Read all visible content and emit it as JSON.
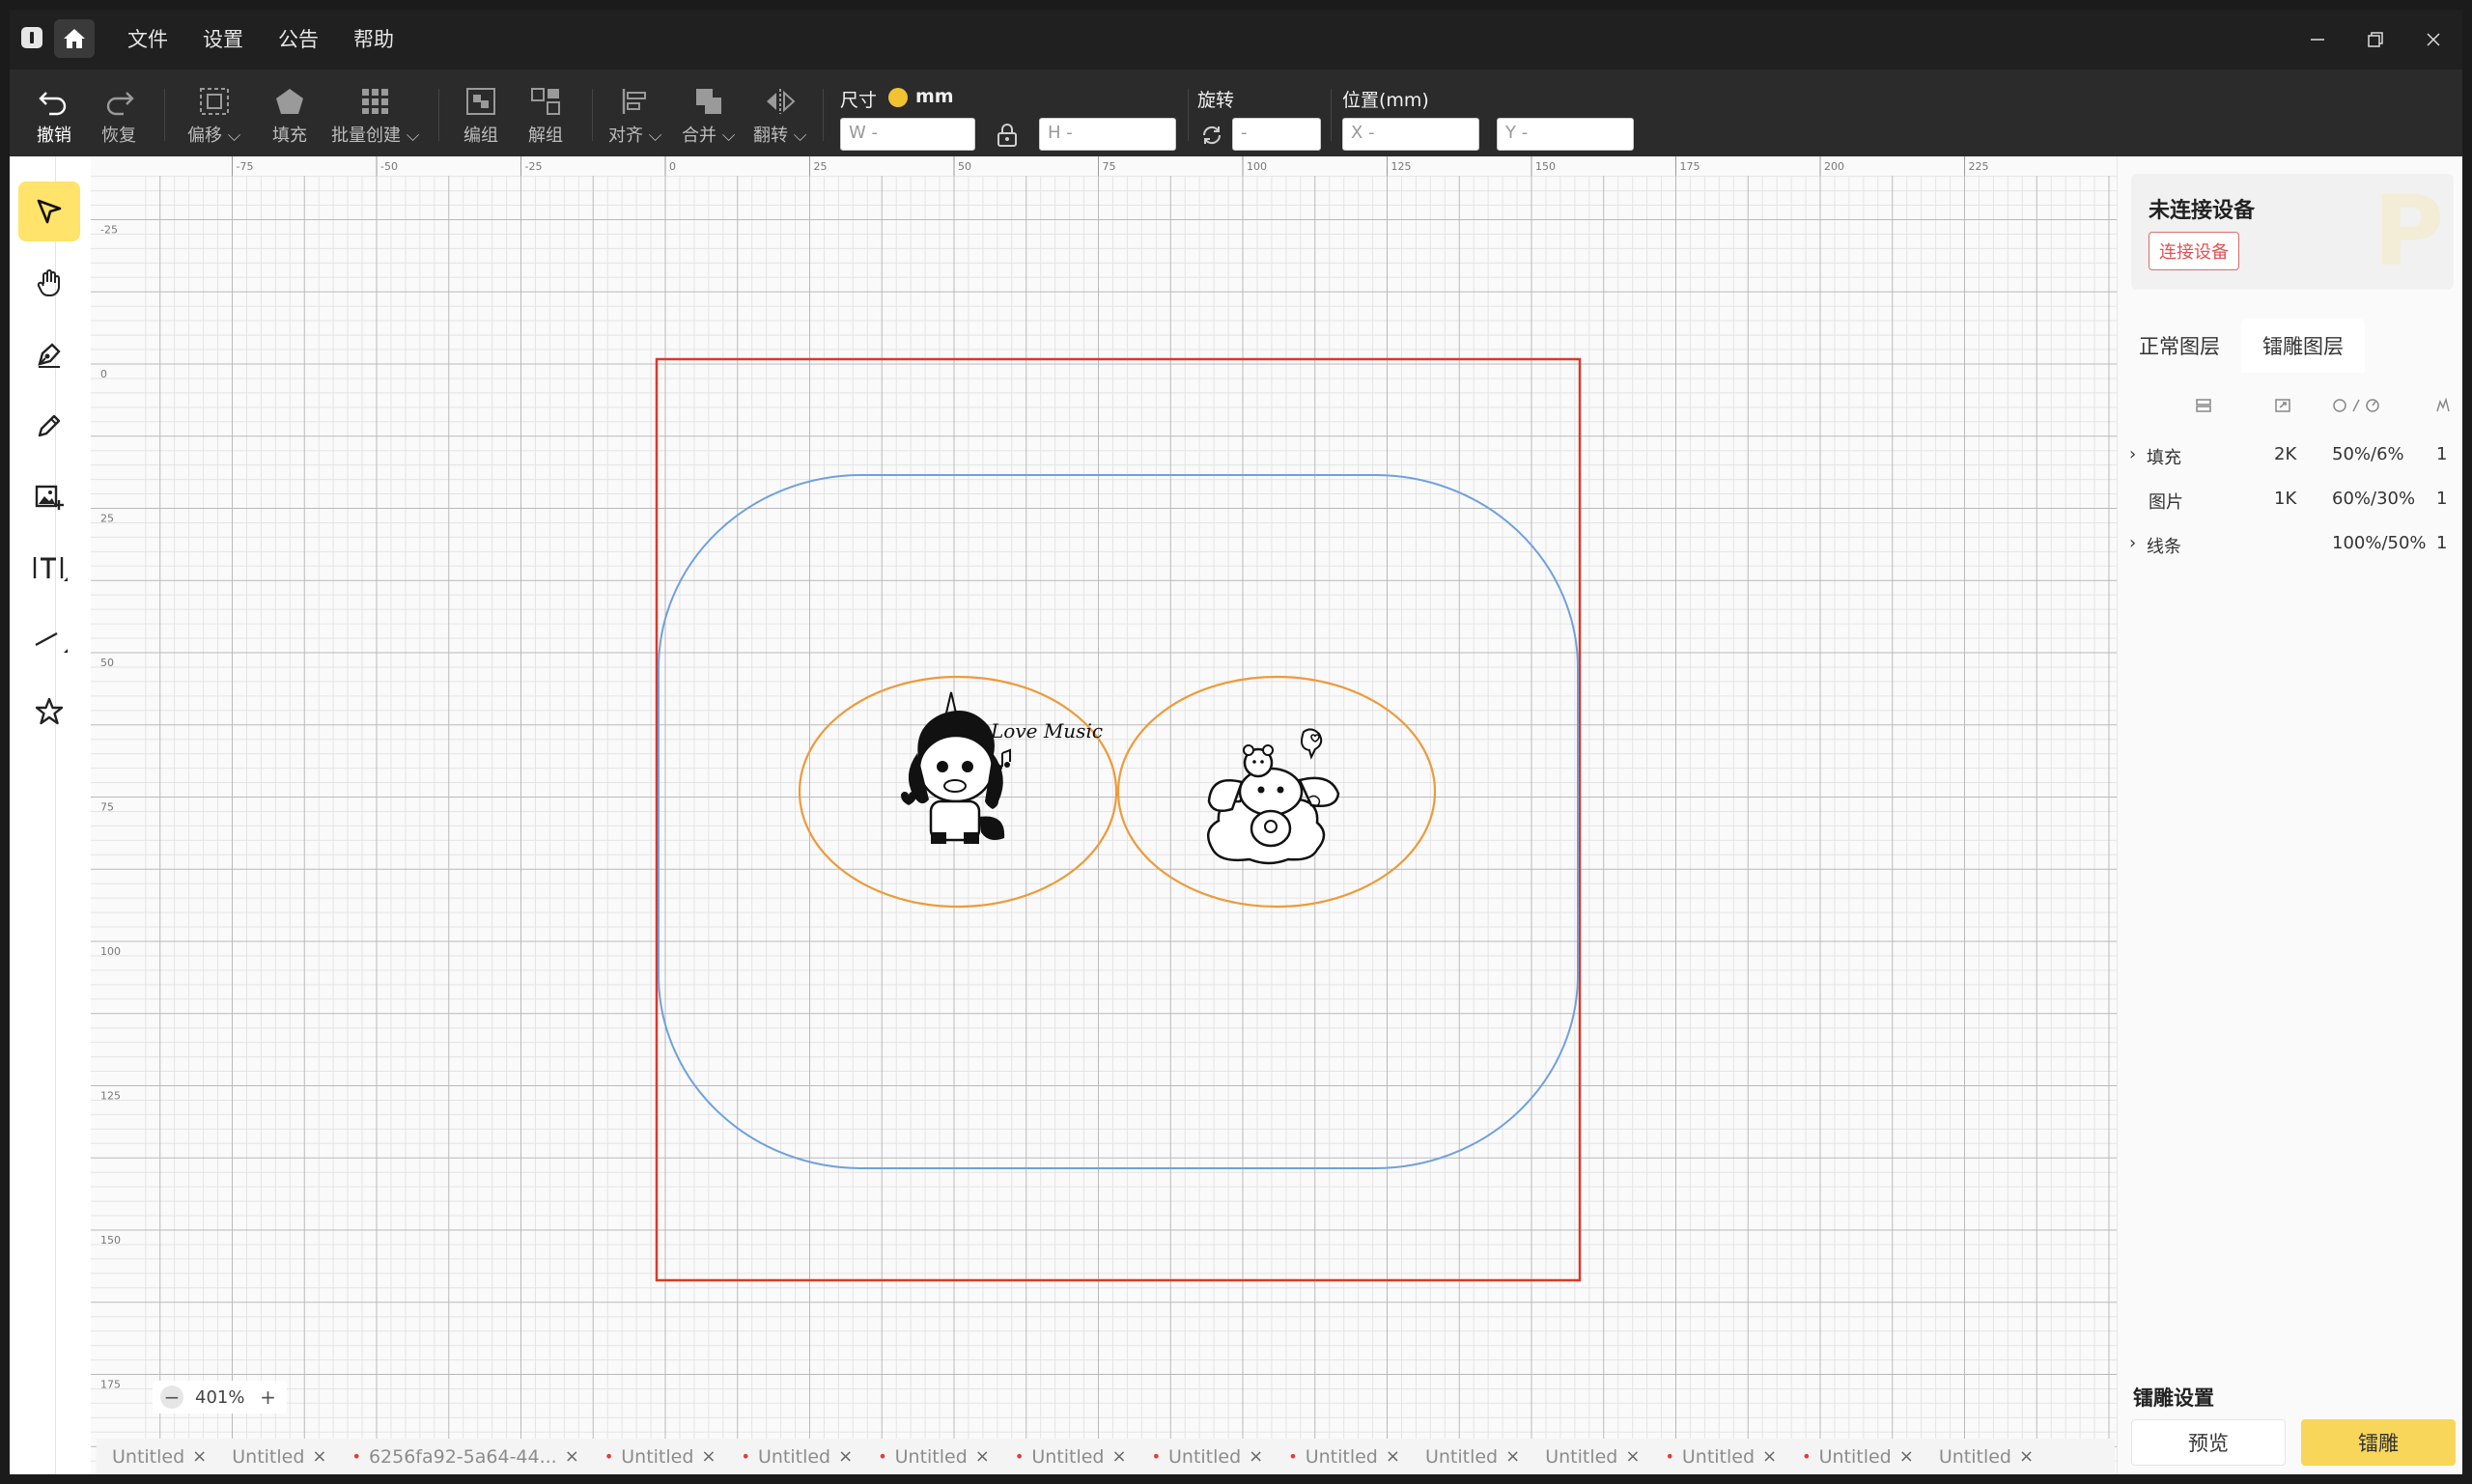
{
  "menu": {
    "items": [
      "文件",
      "设置",
      "公告",
      "帮助"
    ]
  },
  "toolbar": {
    "undo": "撤销",
    "redo": "恢复",
    "offset": "偏移",
    "fill": "填充",
    "batch_create": "批量创建",
    "group": "编组",
    "ungroup": "解组",
    "align": "对齐",
    "merge": "合并",
    "flip": "翻转",
    "size_label": "尺寸",
    "unit": "mm",
    "w_placeholder": "W -",
    "h_placeholder": "H -",
    "rotate_label": "旋转",
    "rotate_placeholder": "-",
    "position_label": "位置(mm)",
    "x_placeholder": "X -",
    "y_placeholder": "Y -"
  },
  "ruler": {
    "x_ticks": [
      "-75",
      "-50",
      "-25",
      "0",
      "25",
      "50",
      "75",
      "100",
      "125",
      "150",
      "175",
      "200",
      "225"
    ],
    "y_ticks": [
      "-25",
      "0",
      "25",
      "50",
      "75",
      "100",
      "125",
      "150",
      "175"
    ]
  },
  "canvas": {
    "zoom": "401%",
    "images": [
      {
        "name": "unicorn-engraving",
        "text": "Love Music"
      },
      {
        "name": "puppy-engraving",
        "text": ""
      }
    ]
  },
  "tabs": [
    {
      "label": "Untitled",
      "unsaved": false
    },
    {
      "label": "Untitled",
      "unsaved": false
    },
    {
      "label": "6256fa92-5a64-44...",
      "unsaved": true
    },
    {
      "label": "Untitled",
      "unsaved": true
    },
    {
      "label": "Untitled",
      "unsaved": true
    },
    {
      "label": "Untitled",
      "unsaved": true
    },
    {
      "label": "Untitled",
      "unsaved": true
    },
    {
      "label": "Untitled",
      "unsaved": true
    },
    {
      "label": "Untitled",
      "unsaved": true
    },
    {
      "label": "Untitled",
      "unsaved": false
    },
    {
      "label": "Untitled",
      "unsaved": false
    },
    {
      "label": "Untitled",
      "unsaved": true
    },
    {
      "label": "Untitled",
      "unsaved": true
    },
    {
      "label": "Untitled",
      "unsaved": false
    }
  ],
  "device": {
    "title": "未连接设备",
    "connect": "连接设备"
  },
  "layer_tabs": {
    "normal": "正常图层",
    "engrave": "镭雕图层"
  },
  "layers": [
    {
      "name": "填充",
      "expandable": true,
      "res": "2K",
      "power_speed": "50%/6%",
      "count": "1"
    },
    {
      "name": "图片",
      "expandable": false,
      "res": "1K",
      "power_speed": "60%/30%",
      "count": "1"
    },
    {
      "name": "线条",
      "expandable": true,
      "res": "",
      "power_speed": "100%/50%",
      "count": "1"
    }
  ],
  "engrave": {
    "title": "镭雕设置",
    "preview": "预览",
    "start": "镭雕"
  },
  "colors": {
    "accent": "#ffe36b",
    "artboard": "#d9392b",
    "rounded_rect": "#6fa0de",
    "ellipse": "#ee9a3a"
  }
}
